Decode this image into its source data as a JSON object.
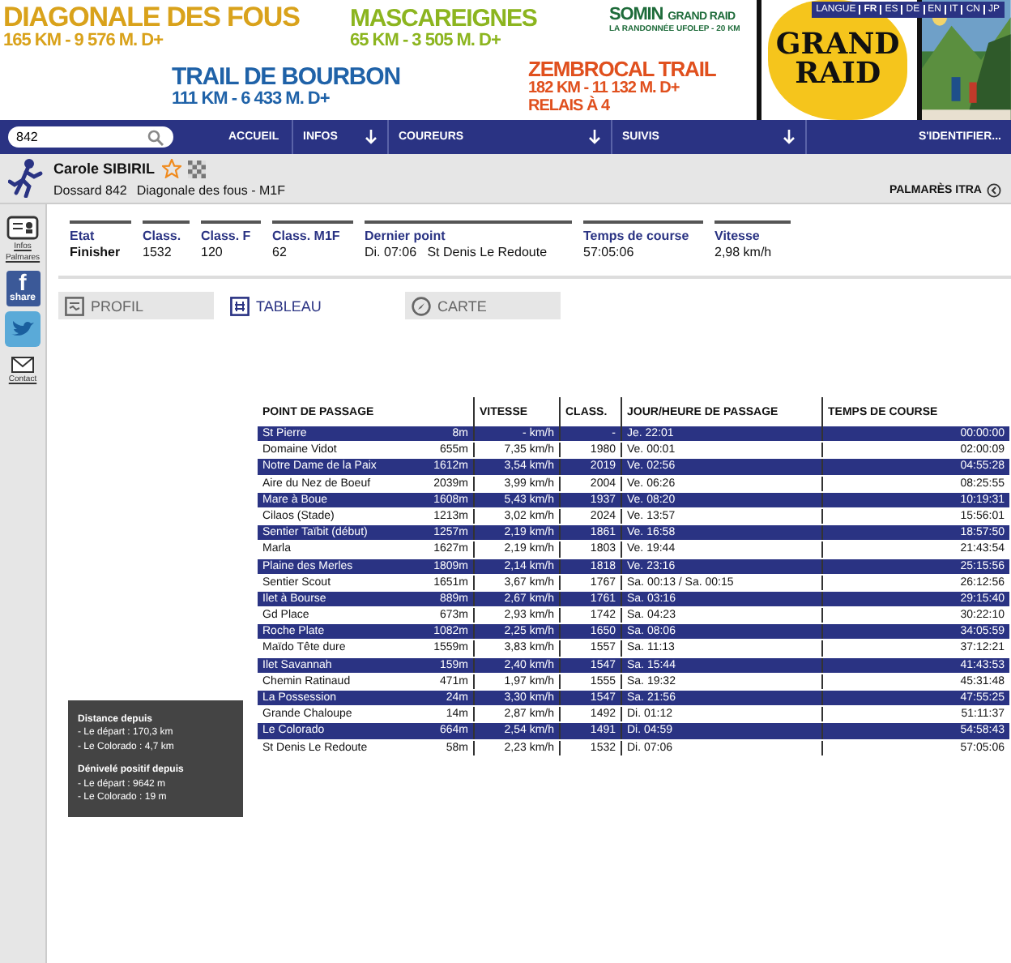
{
  "banner": {
    "races": [
      {
        "kind": "dgf",
        "name": "DIAGONALE DES FOUS",
        "lines": [
          "165 KM - 9 576 M. D+"
        ],
        "color": "#d9a21b"
      },
      {
        "kind": "mascareignes",
        "name": "MASCAREIGNES",
        "lines": [
          "65  KM - 3 505 M. D+"
        ],
        "color": "#8cb51f"
      },
      {
        "kind": "somin",
        "name": "SOMIN",
        "extra": "GRAND RAID",
        "lines": [
          "LA RANDONNÉE UFOLEP - 20 KM"
        ],
        "color": "#1e6b3a"
      },
      {
        "kind": "bourbon",
        "name": "TRAIL DE BOURBON",
        "lines": [
          "111 KM - 6 433 M. D+"
        ],
        "color": "#1f62a8"
      },
      {
        "kind": "zembrocal",
        "name": "ZEMBROCAL TRAIL",
        "lines": [
          "182 KM - 11 132 M. D+",
          "RELAIS À 4"
        ],
        "color": "#e0501e"
      }
    ],
    "language": {
      "label": "LANGUE",
      "options": [
        {
          "code": "FR",
          "selected": true
        },
        {
          "code": "ES",
          "selected": false
        },
        {
          "code": "DE",
          "selected": false
        },
        {
          "code": "EN",
          "selected": false
        },
        {
          "code": "IT",
          "selected": false
        },
        {
          "code": "CN",
          "selected": false
        },
        {
          "code": "JP",
          "selected": false
        }
      ]
    },
    "logo": {
      "top": "GRAND",
      "bottom": "RAID"
    }
  },
  "nav": {
    "search": {
      "value": "842"
    },
    "items": [
      {
        "label": "ACCUEIL",
        "dropdown": false
      },
      {
        "label": "INFOS",
        "dropdown": true
      },
      {
        "label": "COUREURS",
        "dropdown": true
      },
      {
        "label": "SUIVIS",
        "dropdown": true
      }
    ],
    "login": "S'IDENTIFIER..."
  },
  "runner": {
    "name": "Carole SIBIRIL",
    "favorite": false,
    "bib": "Dossard 842",
    "race": "Diagonale des fous - M1F",
    "itra": "PALMARÈS ITRA"
  },
  "sidebar": {
    "infos": [
      "Infos",
      "Palmares"
    ],
    "share_logo": "f",
    "share": "share",
    "contact": "Contact"
  },
  "stats": [
    {
      "label": "Etat",
      "value": "Finisher",
      "bold": true
    },
    {
      "label": "Class.",
      "value": "1532",
      "bold": false
    },
    {
      "label": "Class. F",
      "value": "120",
      "bold": false
    },
    {
      "label": "Class. M1F",
      "value": "62",
      "bold": false
    },
    {
      "label": "Dernier point",
      "value": "Di. 07:06   St Denis Le Redoute",
      "bold": false
    },
    {
      "label": "Temps de course",
      "value": "57:05:06",
      "bold": false
    },
    {
      "label": "Vitesse",
      "value": "2,98 km/h",
      "bold": false
    }
  ],
  "view_tabs": [
    {
      "kind": "profil",
      "label": "PROFIL",
      "selected": false
    },
    {
      "kind": "tableau",
      "label": "TABLEAU",
      "selected": true
    },
    {
      "kind": "carte",
      "label": "CARTE",
      "selected": false
    }
  ],
  "table": {
    "columns": [
      "POINT DE PASSAGE",
      "VITESSE",
      "CLASS.",
      "JOUR/HEURE DE PASSAGE",
      "TEMPS DE COURSE"
    ],
    "rows": [
      {
        "point": "St Pierre",
        "altitude": "8m",
        "vitesse": "- km/h",
        "class": "-",
        "passage": "Je. 22:01",
        "temps": "00:00:00"
      },
      {
        "point": "Domaine Vidot",
        "altitude": "655m",
        "vitesse": "7,35 km/h",
        "class": "1980",
        "passage": "Ve. 00:01",
        "temps": "02:00:09"
      },
      {
        "point": "Notre Dame de la Paix",
        "altitude": "1612m",
        "vitesse": "3,54 km/h",
        "class": "2019",
        "passage": "Ve. 02:56",
        "temps": "04:55:28"
      },
      {
        "point": "Aire du Nez de Boeuf",
        "altitude": "2039m",
        "vitesse": "3,99 km/h",
        "class": "2004",
        "passage": "Ve. 06:26",
        "temps": "08:25:55"
      },
      {
        "point": "Mare à Boue",
        "altitude": "1608m",
        "vitesse": "5,43 km/h",
        "class": "1937",
        "passage": "Ve. 08:20",
        "temps": "10:19:31"
      },
      {
        "point": "Cilaos (Stade)",
        "altitude": "1213m",
        "vitesse": "3,02 km/h",
        "class": "2024",
        "passage": "Ve. 13:57",
        "temps": "15:56:01"
      },
      {
        "point": "Sentier Taïbit (début)",
        "altitude": "1257m",
        "vitesse": "2,19 km/h",
        "class": "1861",
        "passage": "Ve. 16:58",
        "temps": "18:57:50"
      },
      {
        "point": "Marla",
        "altitude": "1627m",
        "vitesse": "2,19 km/h",
        "class": "1803",
        "passage": "Ve. 19:44",
        "temps": "21:43:54"
      },
      {
        "point": "Plaine des Merles",
        "altitude": "1809m",
        "vitesse": "2,14 km/h",
        "class": "1818",
        "passage": "Ve. 23:16",
        "temps": "25:15:56"
      },
      {
        "point": "Sentier Scout",
        "altitude": "1651m",
        "vitesse": "3,67 km/h",
        "class": "1767",
        "passage": "Sa. 00:13 / Sa. 00:15",
        "temps": "26:12:56"
      },
      {
        "point": "Ilet à Bourse",
        "altitude": "889m",
        "vitesse": "2,67 km/h",
        "class": "1761",
        "passage": "Sa. 03:16",
        "temps": "29:15:40"
      },
      {
        "point": "Gd Place",
        "altitude": "673m",
        "vitesse": "2,93 km/h",
        "class": "1742",
        "passage": "Sa. 04:23",
        "temps": "30:22:10"
      },
      {
        "point": "Roche Plate",
        "altitude": "1082m",
        "vitesse": "2,25 km/h",
        "class": "1650",
        "passage": "Sa. 08:06",
        "temps": "34:05:59"
      },
      {
        "point": "Maïdo Tête dure",
        "altitude": "1559m",
        "vitesse": "3,83 km/h",
        "class": "1557",
        "passage": "Sa. 11:13",
        "temps": "37:12:21"
      },
      {
        "point": "Ilet Savannah",
        "altitude": "159m",
        "vitesse": "2,40 km/h",
        "class": "1547",
        "passage": "Sa. 15:44",
        "temps": "41:43:53"
      },
      {
        "point": "Chemin Ratinaud",
        "altitude": "471m",
        "vitesse": "1,97 km/h",
        "class": "1555",
        "passage": "Sa. 19:32",
        "temps": "45:31:48"
      },
      {
        "point": "La Possession",
        "altitude": "24m",
        "vitesse": "3,30 km/h",
        "class": "1547",
        "passage": "Sa. 21:56",
        "temps": "47:55:25"
      },
      {
        "point": "Grande Chaloupe",
        "altitude": "14m",
        "vitesse": "2,87 km/h",
        "class": "1492",
        "passage": "Di. 01:12",
        "temps": "51:11:37"
      },
      {
        "point": "Le Colorado",
        "altitude": "664m",
        "vitesse": "2,54 km/h",
        "class": "1491",
        "passage": "Di. 04:59",
        "temps": "54:58:43"
      },
      {
        "point": "St Denis Le Redoute",
        "altitude": "58m",
        "vitesse": "2,23 km/h",
        "class": "1532",
        "passage": "Di. 07:06",
        "temps": "57:05:06"
      }
    ]
  },
  "tooltip": [
    {
      "title": "Distance depuis",
      "lines": [
        "- Le départ : 170,3 km",
        "- Le Colorado : 4,7 km"
      ]
    },
    {
      "title": "Dénivelé positif depuis",
      "lines": [
        "- Le départ : 9642 m",
        "- Le Colorado : 19 m"
      ]
    }
  ]
}
